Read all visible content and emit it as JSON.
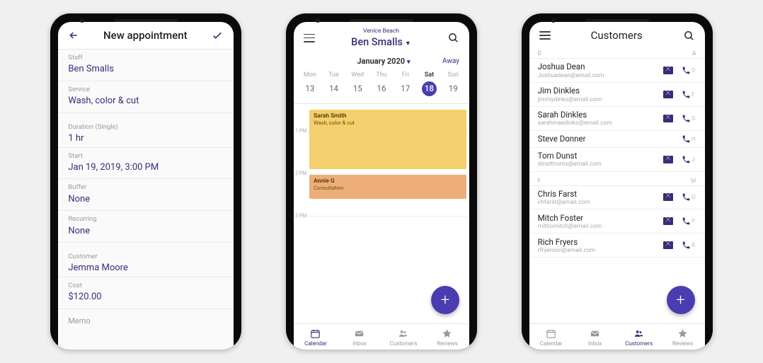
{
  "colors": {
    "primary": "#4a3db0",
    "primaryDark": "#3b2c7a"
  },
  "screen1": {
    "title": "New appointment",
    "fields": {
      "staff": {
        "label": "Staff",
        "value": "Ben Smalls"
      },
      "service": {
        "label": "Service",
        "value": "Wash, color & cut"
      },
      "duration": {
        "label": "Duration (Single)",
        "value": "1 hr"
      },
      "start": {
        "label": "Start",
        "value": "Jan 19, 2019, 3:00 PM"
      },
      "buffer": {
        "label": "Buffer",
        "value": "None"
      },
      "recurring": {
        "label": "Recurring",
        "value": "None"
      },
      "customer": {
        "label": "Customer",
        "value": "Jemma Moore"
      },
      "cost": {
        "label": "Cost",
        "value": "$120.00"
      },
      "memo": {
        "label": "Memo"
      }
    }
  },
  "screen2": {
    "location": "Venice Beach",
    "staff": "Ben Smalls",
    "month": "January 2020",
    "away": "Away",
    "days": [
      {
        "name": "Mon",
        "num": "13"
      },
      {
        "name": "Tue",
        "num": "14"
      },
      {
        "name": "Wed",
        "num": "15"
      },
      {
        "name": "Thu",
        "num": "16"
      },
      {
        "name": "Fri",
        "num": "17"
      },
      {
        "name": "Sat",
        "num": "18",
        "selected": true
      },
      {
        "name": "Sun",
        "num": "19"
      }
    ],
    "hours": [
      "1 PM",
      "2 PM",
      "3 PM"
    ],
    "events": [
      {
        "title": "Sarah Smith",
        "sub": "Wash, color & cut"
      },
      {
        "title": "Annie G",
        "sub": "Consultation"
      }
    ],
    "nav": {
      "calendar": "Calendar",
      "inbox": "Inbox",
      "customers": "Customers",
      "reviews": "Reviews"
    },
    "fab": "+"
  },
  "screen3": {
    "title": "Customers",
    "sections": [
      {
        "letter": "D",
        "right": "A"
      },
      {
        "letter": "F",
        "right": ""
      }
    ],
    "customers": [
      {
        "name": "Joshua Dean",
        "email": "Jushuadean@email.com",
        "mail": true,
        "phone": true,
        "r": "D"
      },
      {
        "name": "Jim Dinkles",
        "email": "jimmydinks@email.com",
        "mail": true,
        "phone": true,
        "r": "F"
      },
      {
        "name": "Sarah Dinkles",
        "email": "sarahmaedinks@email.com",
        "mail": true,
        "phone": true,
        "r": "G"
      },
      {
        "name": "Steve Donner",
        "email": "",
        "mail": false,
        "phone": true,
        "r": "H"
      },
      {
        "name": "Tom Dunst",
        "email": "dinstthoms@email.com",
        "mail": true,
        "phone": true,
        "r": "J"
      },
      {
        "name": "",
        "email": "",
        "mail": false,
        "phone": false,
        "r": "M"
      },
      {
        "name": "Chris Farst",
        "email": "chfarst@email.com",
        "mail": true,
        "phone": true,
        "r": "O"
      },
      {
        "name": "Mitch Foster",
        "email": "mithomitch@email.com",
        "mail": true,
        "phone": true,
        "r": "P"
      },
      {
        "name": "Rich Fryers",
        "email": "rfryerson@email.com",
        "mail": true,
        "phone": true,
        "r": "R"
      }
    ],
    "fab": "+"
  }
}
